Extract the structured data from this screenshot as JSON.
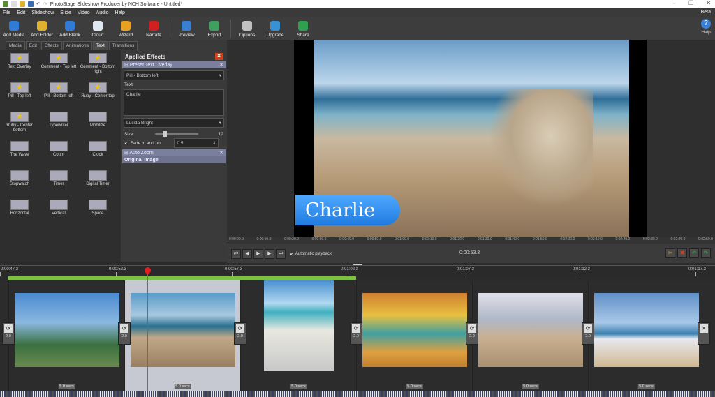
{
  "window": {
    "title": "PhotoStage Slideshow Producer by NCH Software - Untitled*",
    "beta": "Beta"
  },
  "menu": [
    "File",
    "Edit",
    "Slideshow",
    "Slide",
    "Video",
    "Audio",
    "Help"
  ],
  "toolbar": [
    {
      "label": "Add Media",
      "icon": "add-media-icon",
      "color": "#2f7bd6"
    },
    {
      "label": "Add Folder",
      "icon": "add-folder-icon",
      "color": "#e0b030"
    },
    {
      "label": "Add Blank",
      "icon": "add-blank-icon",
      "color": "#2f7bd6"
    },
    {
      "label": "Cloud",
      "icon": "cloud-icon",
      "color": "#dfe8f0"
    },
    {
      "label": "Wizard",
      "icon": "wizard-icon",
      "color": "#e8a020"
    },
    {
      "label": "Narrate",
      "icon": "narrate-icon",
      "color": "#d02020"
    },
    {
      "label": "Preview",
      "icon": "preview-icon",
      "color": "#3a80d0"
    },
    {
      "label": "Export",
      "icon": "export-icon",
      "color": "#40a060"
    },
    {
      "label": "Options",
      "icon": "options-icon",
      "color": "#c0c0c0"
    },
    {
      "label": "Upgrade",
      "icon": "upgrade-icon",
      "color": "#3a90d0"
    },
    {
      "label": "Share",
      "icon": "share-icon",
      "color": "#30a050"
    }
  ],
  "help_label": "Help",
  "tabs": [
    {
      "label": "Media"
    },
    {
      "label": "Edit"
    },
    {
      "label": "Effects"
    },
    {
      "label": "Animations"
    },
    {
      "label": "Text",
      "active": true
    },
    {
      "label": "Transitions"
    }
  ],
  "effects": [
    "Text Overlay",
    "Comment - Top left",
    "Comment - Bottom right",
    "Pill - Top left",
    "Pill - Bottom left",
    "Ruby - Center top",
    "Ruby - Center bottom",
    "Typewriter",
    "Mobilize",
    "The Wave",
    "Count",
    "Clock",
    "Stopwatch",
    "Timer",
    "Digital Timer",
    "Horizontal",
    "Vertical",
    "Space"
  ],
  "applied": {
    "title": "Applied Effects",
    "preset": "Preset Text Overlay",
    "style": "Pill - Bottom left",
    "text_label": "Text:",
    "text_value": "Charlie",
    "font": "Lucida Bright",
    "size_label": "Size:",
    "size_value": "12",
    "size_fraction": 0.2,
    "fade_label": "Fade in and out",
    "fade_checked": true,
    "fade_value": "0.5",
    "auto_zoom": "Auto Zoom",
    "original": "Original Image"
  },
  "preview": {
    "overlay_text": "Charlie",
    "ruler": [
      "0:00:00.0",
      "0:00:10.0",
      "0:00:20.0",
      "0:00:30.0",
      "0:00:40.0",
      "0:00:50.0",
      "0:01:00.0",
      "0:01:10.0",
      "0:01:20.0",
      "0:01:30.0",
      "0:01:40.0",
      "0:01:50.0",
      "0:02:00.0",
      "0:02:10.0",
      "0:02:20.0",
      "0:02:30.0",
      "0:02:40.0",
      "0:02:50.0"
    ],
    "auto_playback": "Automatic playback",
    "timecode": "0:00:53.3"
  },
  "timeline": {
    "ticks": [
      "0:00:47.3",
      "0:00:52.3",
      "0:00:57.3",
      "0:01:02.3",
      "0:01:07.3",
      "0:01:12.3",
      "0:01:17.3"
    ],
    "clips": [
      {
        "duration": "5.0 secs",
        "transition": "2.0"
      },
      {
        "duration": "5.0 secs",
        "transition": "2.0",
        "selected": true
      },
      {
        "duration": "5.0 secs",
        "transition": "2.0"
      },
      {
        "duration": "5.0 secs",
        "transition": "2.0"
      },
      {
        "duration": "5.0 secs",
        "transition": "2.0"
      },
      {
        "duration": "5.0 secs",
        "transition": "2.0"
      }
    ]
  }
}
